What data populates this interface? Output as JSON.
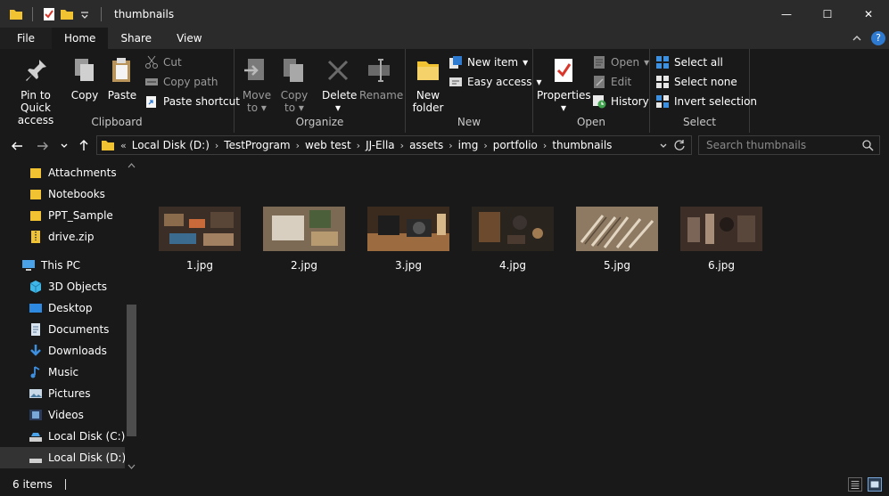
{
  "window": {
    "title": "thumbnails",
    "controls": {
      "minimize": "—",
      "maximize": "☐",
      "close": "✕"
    }
  },
  "tabs": {
    "file": "File",
    "home": "Home",
    "share": "Share",
    "view": "View",
    "help": "?"
  },
  "ribbon": {
    "clipboard": {
      "label": "Clipboard",
      "pin": [
        "Pin to Quick",
        "access"
      ],
      "copy": "Copy",
      "paste": "Paste",
      "cut": "Cut",
      "copy_path": "Copy path",
      "paste_shortcut": "Paste shortcut"
    },
    "organize": {
      "label": "Organize",
      "move_to": [
        "Move",
        "to"
      ],
      "copy_to": [
        "Copy",
        "to"
      ],
      "delete": "Delete",
      "rename": "Rename"
    },
    "new": {
      "label": "New",
      "new_folder": [
        "New",
        "folder"
      ],
      "new_item": "New item",
      "easy_access": "Easy access"
    },
    "open": {
      "label": "Open",
      "properties": "Properties",
      "open": "Open",
      "edit": "Edit",
      "history": "History"
    },
    "select": {
      "label": "Select",
      "select_all": "Select all",
      "select_none": "Select none",
      "invert_selection": "Invert selection"
    }
  },
  "address": {
    "overflow": "«",
    "crumbs": [
      "Local Disk (D:)",
      "TestProgram",
      "web test",
      "JJ-Ella",
      "assets",
      "img",
      "portfolio",
      "thumbnails"
    ],
    "separator": "›",
    "search_placeholder": "Search thumbnails"
  },
  "sidebar": {
    "items": [
      {
        "label": "Attachments",
        "icon": "folder-icon"
      },
      {
        "label": "Notebooks",
        "icon": "folder-icon"
      },
      {
        "label": "PPT_Sample",
        "icon": "folder-icon"
      },
      {
        "label": "drive.zip",
        "icon": "zip-icon"
      },
      {
        "label": "This PC",
        "icon": "pc-icon"
      },
      {
        "label": "3D Objects",
        "icon": "3d-objects-icon"
      },
      {
        "label": "Desktop",
        "icon": "desktop-icon"
      },
      {
        "label": "Documents",
        "icon": "documents-icon"
      },
      {
        "label": "Downloads",
        "icon": "downloads-icon"
      },
      {
        "label": "Music",
        "icon": "music-icon"
      },
      {
        "label": "Pictures",
        "icon": "pictures-icon"
      },
      {
        "label": "Videos",
        "icon": "videos-icon"
      },
      {
        "label": "Local Disk (C:)",
        "icon": "drive-icon"
      },
      {
        "label": "Local Disk (D:)",
        "icon": "drive-icon"
      }
    ],
    "selected": "Local Disk (D:)"
  },
  "files": [
    {
      "name": "1.jpg",
      "colors": [
        "#3a2e26",
        "#8a6b4c",
        "#c96a3a",
        "#3b6b8f"
      ]
    },
    {
      "name": "2.jpg",
      "colors": [
        "#7d6a55",
        "#d9cfc0",
        "#4a5f3a",
        "#b89a70"
      ]
    },
    {
      "name": "3.jpg",
      "colors": [
        "#3b2a1e",
        "#9c6b3f",
        "#1d1d1d",
        "#d7b88a"
      ]
    },
    {
      "name": "4.jpg",
      "colors": [
        "#2a241f",
        "#6b4a2e",
        "#3a3330",
        "#a07a50"
      ]
    },
    {
      "name": "5.jpg",
      "colors": [
        "#8e7a62",
        "#cbb79a",
        "#5a4a3a",
        "#e2d6c2"
      ]
    },
    {
      "name": "6.jpg",
      "colors": [
        "#3d2f28",
        "#7a6556",
        "#221b18",
        "#a88d78"
      ]
    }
  ],
  "status": {
    "count": "6 items"
  },
  "colors": {
    "folder": "#f1c232",
    "accent": "#2e7ad1"
  }
}
